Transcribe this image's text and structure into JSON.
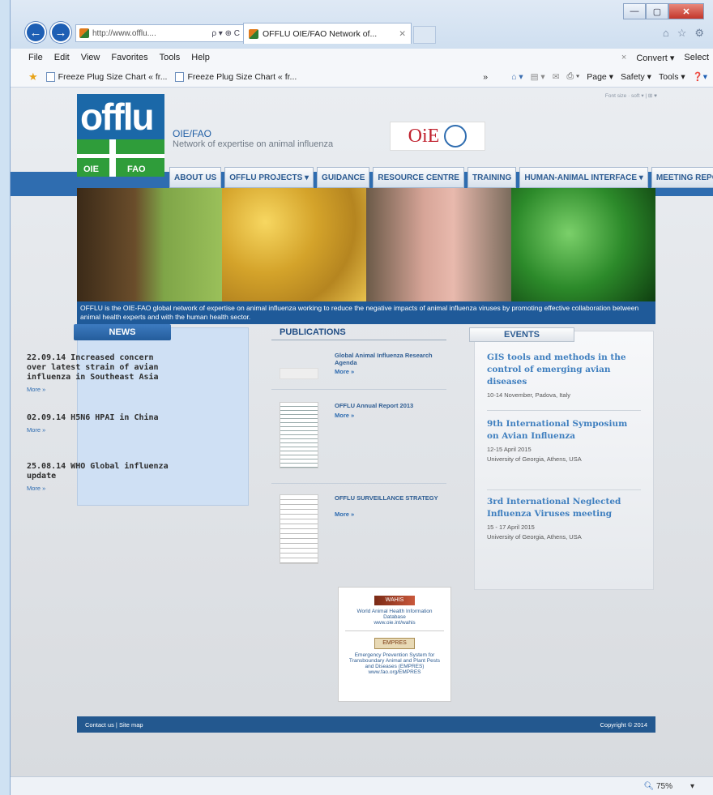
{
  "browser": {
    "address": "http://www.offlu....",
    "address_icons": "ρ ▾ ⊕ C",
    "tab_title": "OFFLU OIE/FAO Network of...",
    "back_label": "←",
    "forward_label": "→",
    "minimize_label": "—",
    "maximize_label": "▢",
    "close_label": "✕",
    "home_icon": "⌂",
    "favorites_icon": "☆",
    "settings_icon": "⚙",
    "menu": [
      "File",
      "Edit",
      "View",
      "Favorites",
      "Tools",
      "Help"
    ],
    "menu_right": {
      "close": "×",
      "convert": "Convert ▾",
      "select": "Select"
    },
    "favorites_bar": [
      "Freeze Plug Size Chart « fr...",
      "Freeze Plug Size Chart « fr..."
    ],
    "command_bar": [
      "Page ▾",
      "Safety ▾",
      "Tools ▾"
    ],
    "chevron": "»",
    "zoom": "75%",
    "zoom_arrow": "▾"
  },
  "site": {
    "logo_text": "offlu",
    "logo_left": "OIE",
    "logo_right": "FAO",
    "title": "OIE/FAO",
    "subtitle": "Network of expertise on animal influenza",
    "oie_text": "OiE",
    "top_links": "Font size · soft ▾ | ⊞ ♥",
    "nav": [
      "ABOUT US",
      "OFFLU PROJECTS ▾",
      "GUIDANCE",
      "RESOURCE CENTRE",
      "TRAINING",
      "HUMAN-ANIMAL INTERFACE ▾",
      "MEETING REPORTS"
    ],
    "tagline": "OFFLU is the OIE-FAO global network of expertise on animal influenza working to reduce the negative impacts of animal influenza viruses by promoting effective collaboration between animal health experts and with the human health sector."
  },
  "news": {
    "heading": "NEWS",
    "items": [
      {
        "title": "22.09.14 Increased concern over latest strain of avian influenza in Southeast Asia",
        "more": "More »"
      },
      {
        "title": "02.09.14 H5N6 HPAI in China",
        "more": "More »"
      },
      {
        "title": "25.08.14 WHO Global influenza update",
        "more": "More »"
      }
    ]
  },
  "publications": {
    "heading": "PUBLICATIONS",
    "items": [
      {
        "title": "Global Animal Influenza Research Agenda",
        "more": "More »"
      },
      {
        "title": "OFFLU Annual Report 2013",
        "more": "More »"
      },
      {
        "title": "OFFLU SURVEILLANCE STRATEGY",
        "more": "More »"
      }
    ]
  },
  "events": {
    "heading": "EVENTS",
    "items": [
      {
        "title": "GIS tools and methods in the control of emerging avian diseases",
        "date": "10-14 November, Padova, Italy"
      },
      {
        "title": "9th International Symposium on Avian Influenza",
        "date": "12-15 April 2015",
        "place": "University of Georgia, Athens, USA"
      },
      {
        "title": "3rd International Neglected Influenza Viruses meeting",
        "date": "15 - 17 April 2015",
        "place": "University of Georgia, Athens, USA"
      }
    ]
  },
  "links": {
    "wahis_logo": "WAHIS",
    "wahis_text": "World Animal Health Information Database",
    "wahis_url": "www.oie.int/wahis",
    "empres_logo": "EMPRES",
    "empres_text": "Emergency Prevention System for Transboundary Animal and Plant Pests and Diseases (EMPRES)",
    "empres_url": "www.fao.org/EMPRES"
  },
  "footer": {
    "left": "Contact us | Site map",
    "right": "Copyright © 2014"
  }
}
